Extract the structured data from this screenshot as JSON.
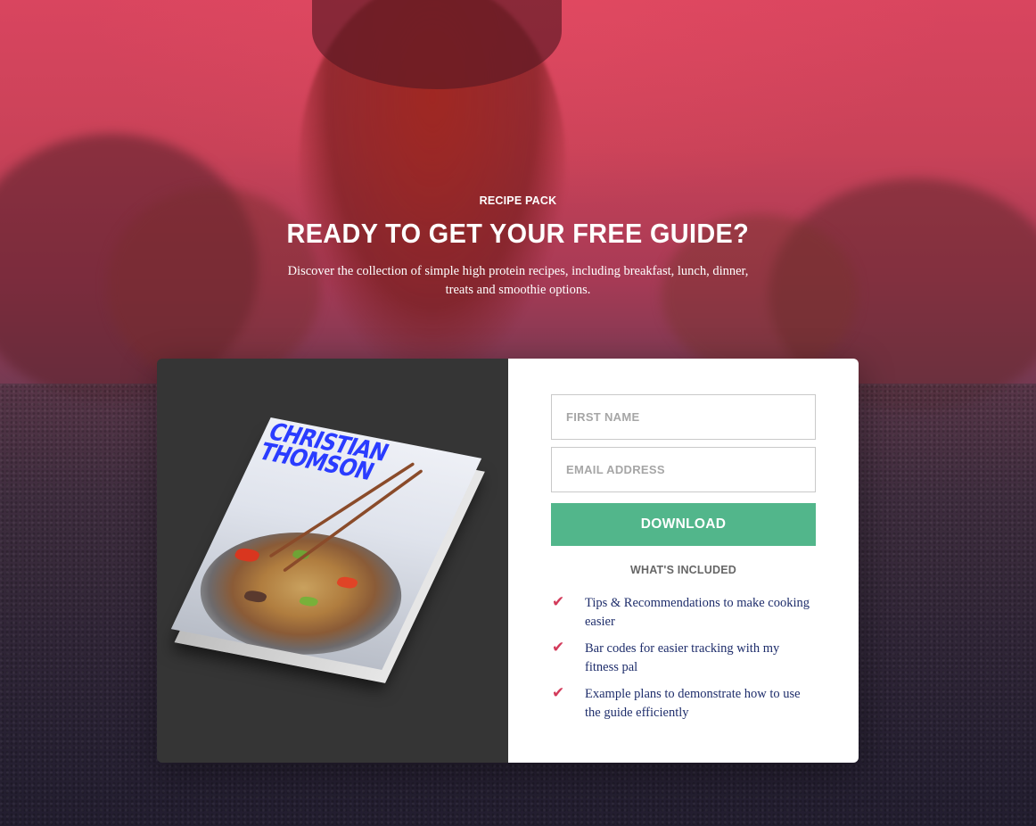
{
  "hero": {
    "kicker": "RECIPE PACK",
    "headline": "READY TO GET YOUR FREE GUIDE?",
    "subline": "Discover the collection of simple high protein recipes, including breakfast, lunch, dinner, treats and smoothie options."
  },
  "book": {
    "cover_title": "CHRISTIAN THOMSON",
    "title_color": "#2a3cff"
  },
  "form": {
    "first_name_placeholder": "FIRST NAME",
    "email_placeholder": "EMAIL ADDRESS",
    "download_label": "DOWNLOAD",
    "button_color": "#52b68b"
  },
  "included": {
    "title": "WHAT'S INCLUDED",
    "check_icon": "check-icon",
    "check_color": "#d33b5b",
    "items": [
      "Tips & Recommendations to make cooking easier",
      "Bar codes for easier tracking with my fitness pal",
      "Example plans to demonstrate how to use the guide efficiently"
    ]
  }
}
